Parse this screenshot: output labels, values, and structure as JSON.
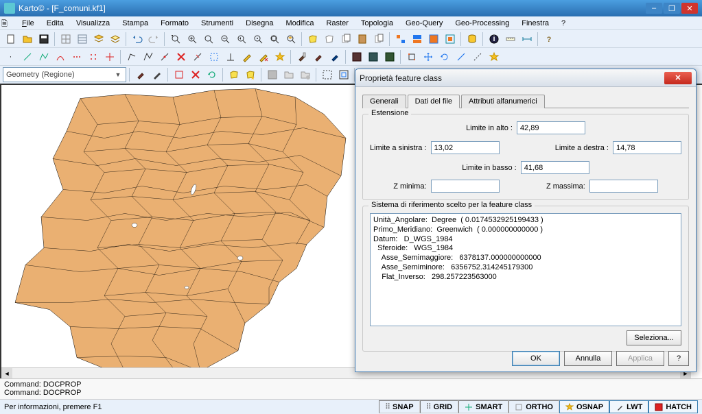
{
  "titlebar": {
    "text": "Karto© - [F_comuni.kf1]"
  },
  "menu": {
    "file": "File",
    "edita": "Edita",
    "visualizza": "Visualizza",
    "stampa": "Stampa",
    "formato": "Formato",
    "strumenti": "Strumenti",
    "disegna": "Disegna",
    "modifica": "Modifica",
    "raster": "Raster",
    "topologia": "Topologia",
    "geoquery": "Geo-Query",
    "geoproc": "Geo-Processing",
    "finestra": "Finestra",
    "help": "?"
  },
  "combo": {
    "text": "Geometry (Regione)"
  },
  "dialog": {
    "title": "Proprietà feature class",
    "tabs": {
      "generali": "Generali",
      "datidelfile": "Dati del file",
      "attributi": "Attributi alfanumerici"
    },
    "group_estensione": "Estensione",
    "labels": {
      "alto": "Limite in alto :",
      "sinistra": "Limite a sinistra :",
      "destra": "Limite a destra :",
      "basso": "Limite in basso :",
      "zmin": "Z minima:",
      "zmax": "Z massima:"
    },
    "values": {
      "alto": "42,89",
      "sinistra": "13,02",
      "destra": "14,78",
      "basso": "41,68",
      "zmin": "",
      "zmax": ""
    },
    "group_srs": "Sistema di riferimento scelto per la feature class",
    "srs_lines": [
      "Unità_Angolare:  Degree  ( 0.0174532925199433 )",
      "Primo_Meridiano:  Greenwich  ( 0.000000000000 )",
      "Datum:   D_WGS_1984",
      "  Sferoide:   WGS_1984",
      "    Asse_Semimaggiore:   6378137.000000000000",
      "    Asse_Semiminore:   6356752.314245179300",
      "    Flat_Inverso:   298.257223563000"
    ],
    "buttons": {
      "seleziona": "Seleziona...",
      "ok": "OK",
      "annulla": "Annulla",
      "applica": "Applica",
      "help": "?"
    }
  },
  "command": {
    "line1": "Command: DOCPROP",
    "line2": "Command: DOCPROP"
  },
  "status": {
    "info": "Per informazioni, premere F1",
    "snap": "SNAP",
    "grid": "GRID",
    "smart": "SMART",
    "ortho": "ORTHO",
    "osnap": "OSNAP",
    "lwt": "LWT",
    "hatch": "HATCH"
  }
}
